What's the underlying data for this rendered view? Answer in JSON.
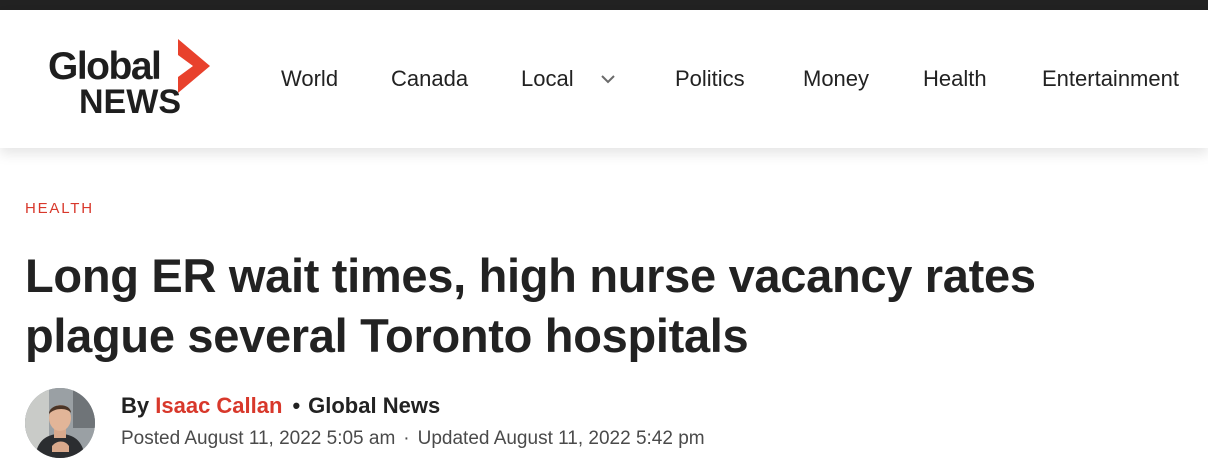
{
  "logo": {
    "line1": "Global",
    "line2": "NEWS",
    "accent_color": "#e8412c"
  },
  "nav": {
    "items": [
      {
        "label": "World"
      },
      {
        "label": "Canada"
      },
      {
        "label": "Local",
        "has_dropdown": true
      },
      {
        "label": "Politics"
      },
      {
        "label": "Money"
      },
      {
        "label": "Health"
      },
      {
        "label": "Entertainment"
      }
    ]
  },
  "article": {
    "category": "HEALTH",
    "headline": "Long ER wait times, high nurse vacancy rates plague several Toronto hospitals",
    "byline_prefix": "By",
    "author": "Isaac Callan",
    "separator": "•",
    "outlet": "Global News",
    "posted": "Posted August 11, 2022 5:05 am",
    "dates_separator": "·",
    "updated": "Updated August 11, 2022 5:42 pm"
  },
  "colors": {
    "accent": "#d8382b",
    "text": "#222222",
    "topbar": "#222222"
  }
}
